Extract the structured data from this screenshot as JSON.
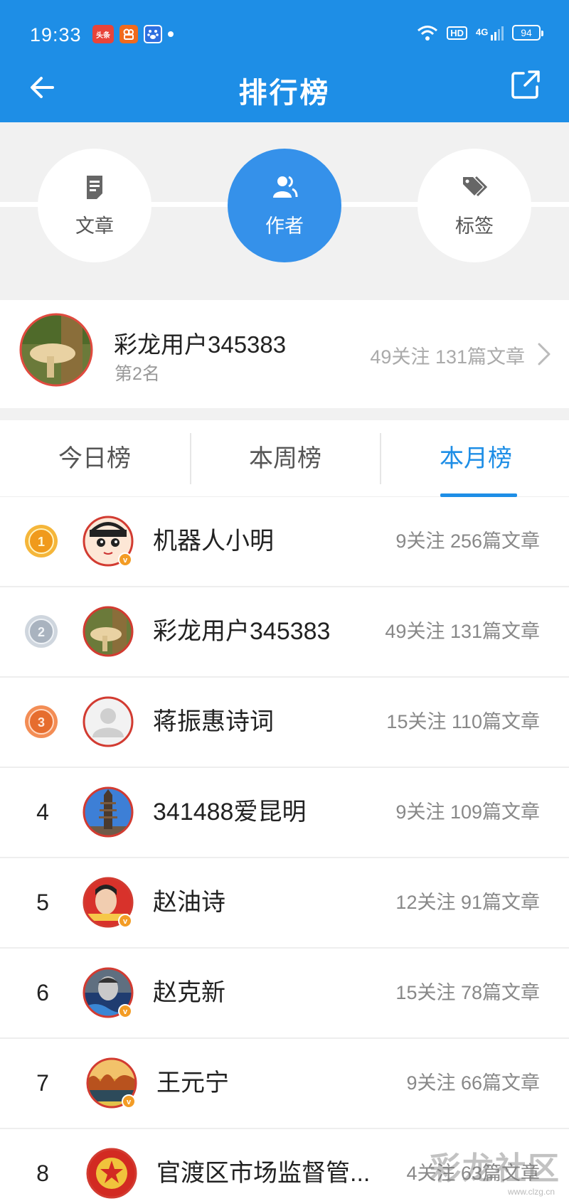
{
  "status_bar": {
    "time": "19:33",
    "apps": [
      "头条",
      "快手",
      "百度"
    ],
    "hd": "HD",
    "network": "4G",
    "battery": "94"
  },
  "header": {
    "title": "排行榜",
    "accent_color": "#1e8ee6"
  },
  "categories": [
    {
      "label": "文章",
      "icon": "document-icon",
      "active": false
    },
    {
      "label": "作者",
      "icon": "users-icon",
      "active": true
    },
    {
      "label": "标签",
      "icon": "tags-icon",
      "active": false
    }
  ],
  "my_rank": {
    "name": "彩龙用户345383",
    "rank": "第2名",
    "stats": "49关注 131篇文章"
  },
  "tabs": [
    {
      "label": "今日榜",
      "active": false
    },
    {
      "label": "本周榜",
      "active": false
    },
    {
      "label": "本月榜",
      "active": true
    }
  ],
  "rows": [
    {
      "rank": "1",
      "medal": "gold",
      "name": "机器人小明",
      "stats": "9关注 256篇文章",
      "verified": true,
      "avatar": "cartoon-boy"
    },
    {
      "rank": "2",
      "medal": "silver",
      "name": "彩龙用户345383",
      "stats": "49关注 131篇文章",
      "verified": false,
      "avatar": "mushroom"
    },
    {
      "rank": "3",
      "medal": "bronze",
      "name": "蒋振惠诗词",
      "stats": "15关注 110篇文章",
      "verified": false,
      "avatar": "default-person"
    },
    {
      "rank": "4",
      "medal": "",
      "name": "341488爱昆明",
      "stats": "9关注 109篇文章",
      "verified": false,
      "avatar": "pagoda"
    },
    {
      "rank": "5",
      "medal": "",
      "name": "赵油诗",
      "stats": "12关注 91篇文章",
      "verified": true,
      "avatar": "portrait-red"
    },
    {
      "rank": "6",
      "medal": "",
      "name": "赵克新",
      "stats": "15关注 78篇文章",
      "verified": true,
      "avatar": "portrait-blue"
    },
    {
      "rank": "7",
      "medal": "",
      "name": "王元宁",
      "stats": "9关注 66篇文章",
      "verified": true,
      "avatar": "autumn-lake"
    },
    {
      "rank": "8",
      "medal": "",
      "name": "官渡区市场监督管...",
      "stats": "4关注 63篇文章",
      "verified": false,
      "avatar": "emblem"
    }
  ],
  "watermark": "彩龙社区",
  "watermark_url": "www.clzg.cn"
}
